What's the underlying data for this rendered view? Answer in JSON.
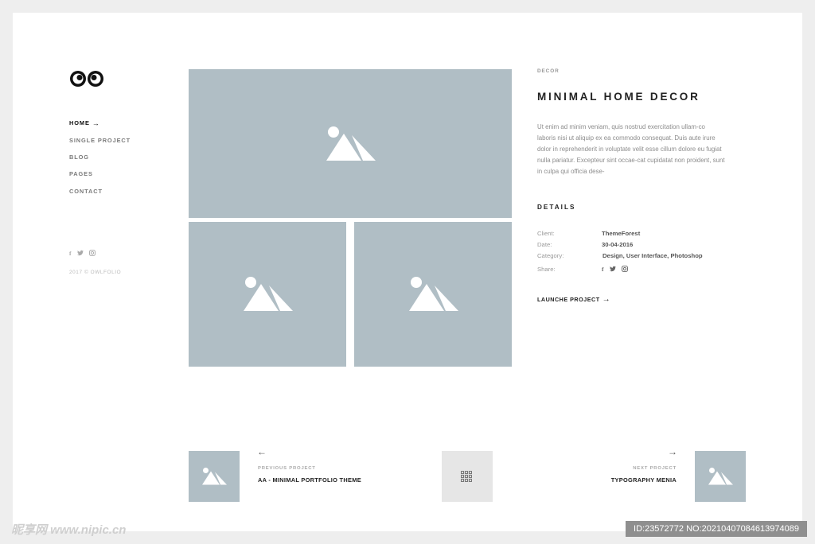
{
  "sidebar": {
    "nav": [
      {
        "label": "HOME",
        "active": true
      },
      {
        "label": "SINGLE PROJECT",
        "active": false
      },
      {
        "label": "BLOG",
        "active": false
      },
      {
        "label": "PAGES",
        "active": false
      },
      {
        "label": "CONTACT",
        "active": false
      }
    ],
    "home_arrow": "→",
    "social_icons": [
      "facebook-icon",
      "twitter-icon",
      "instagram-icon"
    ],
    "copyright": "2017 © OWLFOLIO"
  },
  "project": {
    "category": "DECOR",
    "title": "MINIMAL HOME DECOR",
    "description": "Ut enim ad minim veniam, quis nostrud exercitation ullam-co laboris nisi ut aliquip ex ea commodo consequat. Duis aute irure dolor in reprehenderit in voluptate velit esse cillum dolore eu fugiat nulla pariatur. Excepteur sint occae-cat cupidatat non proident, sunt in culpa qui officia dese-",
    "details_title": "DETAILS",
    "details": {
      "client_label": "Client:",
      "client_value": "ThemeForest",
      "date_label": "Date:",
      "date_value": "30-04-2016",
      "category_label": "Category:",
      "category_value": "Design, User Interface, Photoshop",
      "share_label": "Share:"
    },
    "launch_label": "LAUNCHE PROJECT",
    "launch_arrow": "→"
  },
  "pager": {
    "prev_arrow": "←",
    "prev_label": "PREVIOUS PROJECT",
    "prev_title": "AA - MINIMAL PORTFOLIO THEME",
    "next_arrow": "→",
    "next_label": "NEXT PROJECT",
    "next_title": "TYPOGRAPHY MENIA"
  },
  "watermark": {
    "left": "昵享网 www.nipic.cn",
    "right": "ID:23572772 NO:20210407084613974089"
  },
  "colors": {
    "placeholder": "#b0bec5",
    "page_bg": "#ffffff",
    "outer_bg": "#eeeeee"
  }
}
